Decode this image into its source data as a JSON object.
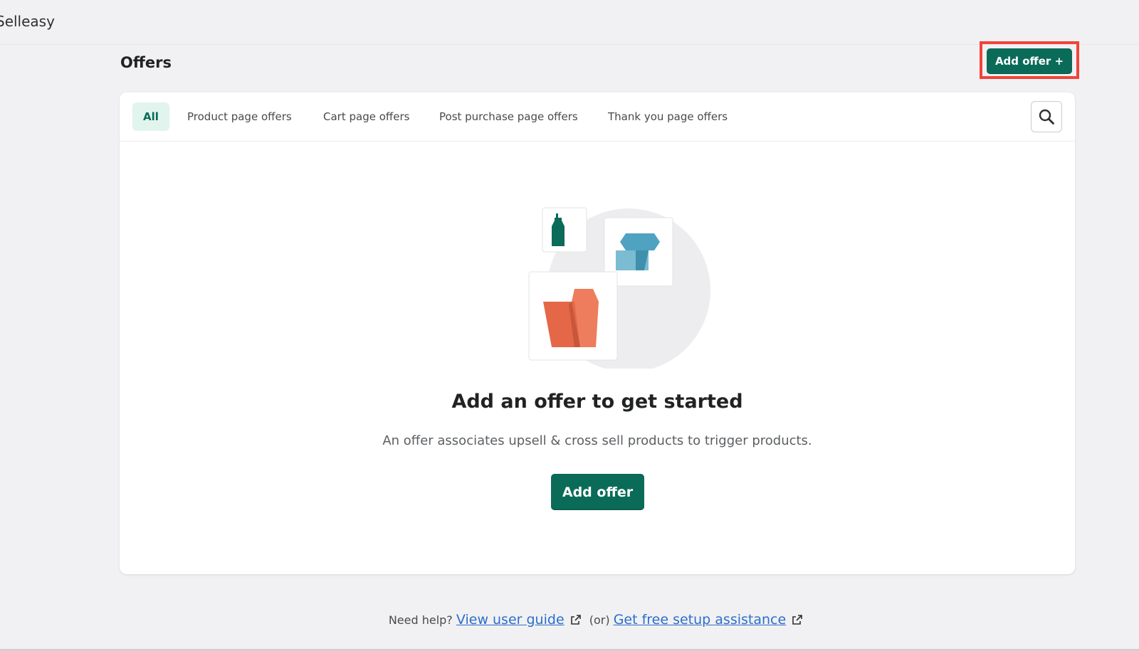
{
  "app": {
    "name": "Selleasy"
  },
  "header": {
    "title": "Offers",
    "add_offer_label": "Add offer +"
  },
  "tabs": [
    {
      "label": "All",
      "active": true
    },
    {
      "label": "Product page offers",
      "active": false
    },
    {
      "label": "Cart page offers",
      "active": false
    },
    {
      "label": "Post purchase page offers",
      "active": false
    },
    {
      "label": "Thank you page offers",
      "active": false
    }
  ],
  "empty_state": {
    "title": "Add an offer to get started",
    "description": "An offer associates upsell & cross sell products to trigger products.",
    "button_label": "Add offer"
  },
  "help": {
    "prefix": "Need help?",
    "user_guide_link": "View user guide",
    "separator": "(or)",
    "setup_link": "Get free setup assistance"
  },
  "colors": {
    "primary": "#0a6b58",
    "highlight": "#f04438",
    "link": "#2c6ecb",
    "active_tab_bg": "#e1f4ee"
  },
  "icons": {
    "search": "search-icon",
    "external_link": "external-link-icon"
  }
}
